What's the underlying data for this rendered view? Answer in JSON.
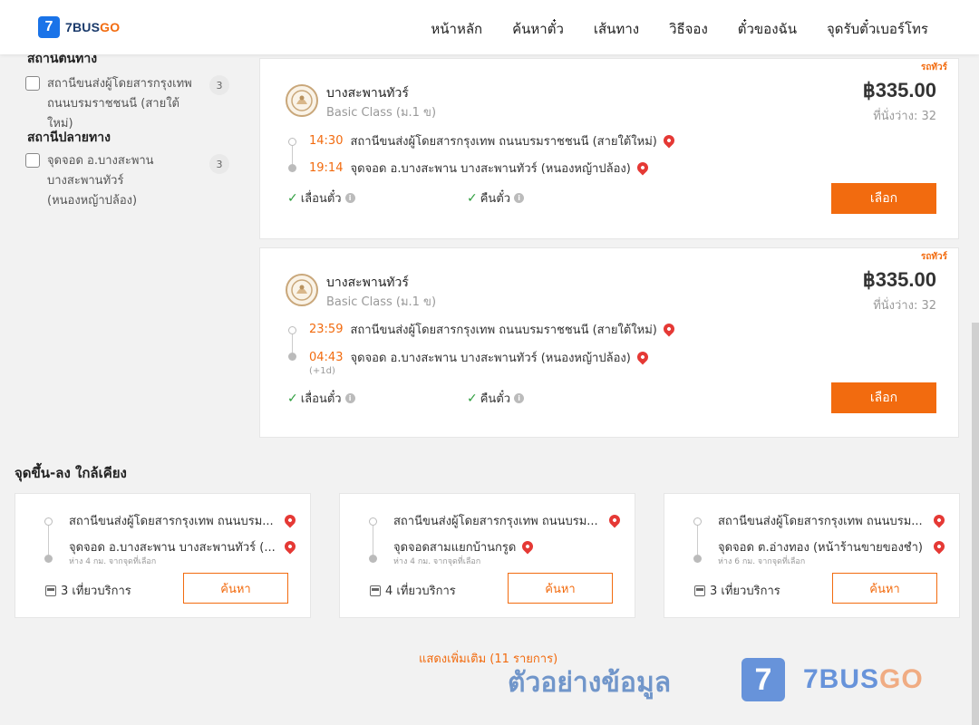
{
  "header": {
    "logo_mark": "7",
    "logo_brand_main": "7BUS",
    "logo_brand_accent": "GO",
    "nav": [
      "หน้าหลัก",
      "ค้นหาตั๋ว",
      "เส้นทาง",
      "วิธีจอง",
      "ตั๋วของฉัน",
      "จุดรับตั๋วเบอร์โทร"
    ]
  },
  "filters": {
    "origin_heading": "สถานีต้นทาง",
    "origin_items": [
      {
        "label": "สถานีขนส่งผู้โดยสารกรุงเทพ ถนนบรมราชชนนี (สายใต้ใหม่)",
        "count": "3"
      }
    ],
    "dest_heading": "สถานีปลายทาง",
    "dest_items": [
      {
        "label": "จุดจอด อ.บางสะพาน บางสะพานทัวร์ (หนองหญ้าปล้อง)",
        "count": "3"
      }
    ]
  },
  "trips": [
    {
      "tag": "รถทัวร์",
      "operator": "บางสะพานทัวร์",
      "class": "Basic Class (ม.1 ข)",
      "price": "฿335.00",
      "seats": "ที่นั่งว่าง: 32",
      "depart_time": "14:30",
      "depart_stop": "สถานีขนส่งผู้โดยสารกรุงเทพ ถนนบรมราชชนนี (สายใต้ใหม่)",
      "arrive_time": "19:14",
      "arrive_stop": "จุดจอด อ.บางสะพาน บางสะพานทัวร์ (หนองหญ้าปล้อง)",
      "plus_day": "",
      "policy_1": "เลื่อนตั๋ว",
      "policy_2": "คืนตั๋ว",
      "button": "เลือก"
    },
    {
      "tag": "รถทัวร์",
      "operator": "บางสะพานทัวร์",
      "class": "Basic Class (ม.1 ข)",
      "price": "฿335.00",
      "seats": "ที่นั่งว่าง: 32",
      "depart_time": "23:59",
      "depart_stop": "สถานีขนส่งผู้โดยสารกรุงเทพ ถนนบรมราชชนนี (สายใต้ใหม่)",
      "arrive_time": "04:43",
      "arrive_stop": "จุดจอด อ.บางสะพาน บางสะพานทัวร์ (หนองหญ้าปล้อง)",
      "plus_day": "(+1d)",
      "policy_1": "เลื่อนตั๋ว",
      "policy_2": "คืนตั๋ว",
      "button": "เลือก"
    }
  ],
  "nearby": {
    "title": "จุดขึ้น-ลง ใกล้เคียง",
    "cards": [
      {
        "from": "สถานีขนส่งผู้โดยสารกรุงเทพ ถนนบรม...",
        "to": "จุดจอด อ.บางสะพาน บางสะพานทัวร์ (...",
        "distance": "ห่าง 4 กม. จากจุดที่เลือก",
        "trips": "3 เที่ยวบริการ",
        "button": "ค้นหา"
      },
      {
        "from": "สถานีขนส่งผู้โดยสารกรุงเทพ ถนนบรม...",
        "to": "จุดจอดสามแยกบ้านกรูด",
        "distance": "ห่าง 4 กม. จากจุดที่เลือก",
        "trips": "4 เที่ยวบริการ",
        "button": "ค้นหา"
      },
      {
        "from": "สถานีขนส่งผู้โดยสารกรุงเทพ ถนนบรม...",
        "to": "จุดจอด ต.อ่างทอง (หน้าร้านขายของชำ)",
        "distance": "ห่าง 6 กม. จากจุดที่เลือก",
        "trips": "3 เที่ยวบริการ",
        "button": "ค้นหา"
      }
    ]
  },
  "show_more": "แสดงเพิ่มเติม (11 รายการ)",
  "watermark": {
    "text": "ตัวอย่างข้อมูล",
    "mark": "7",
    "brand_main": "7BUS",
    "brand_accent": "GO"
  },
  "colors": {
    "accent": "#f26b0f",
    "brand_blue": "#1a73e8",
    "check_green": "#2e9e3e",
    "pin_red": "#e53935"
  },
  "icons": {
    "check": "check-icon",
    "info": "info-icon",
    "pin": "map-pin-icon",
    "bus": "bus-icon"
  }
}
